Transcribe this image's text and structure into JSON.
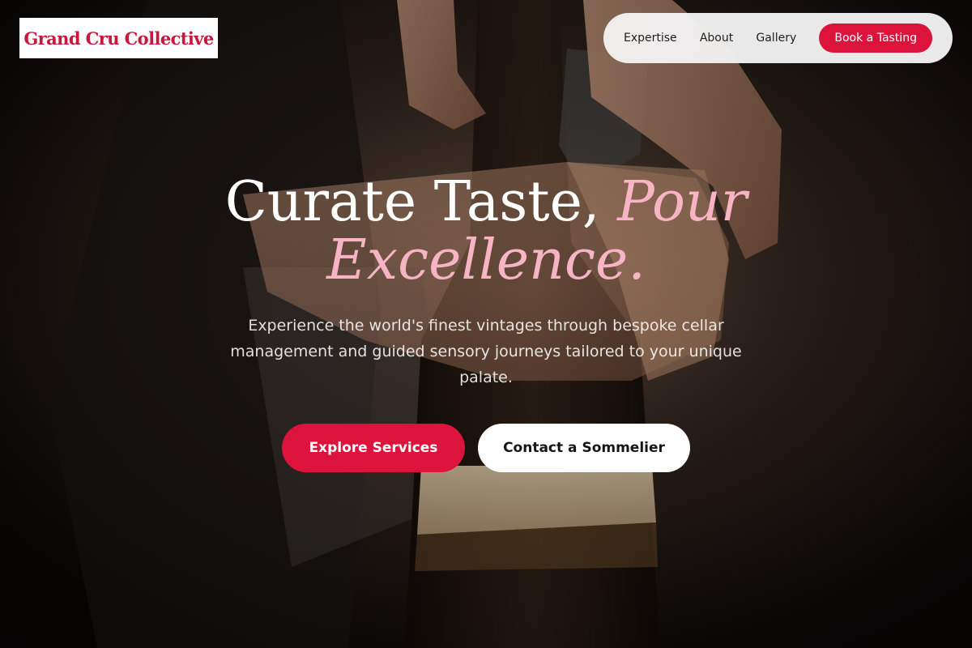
{
  "brand": {
    "logo_text": "Grand Cru Collective"
  },
  "nav": {
    "links": [
      "Expertise",
      "About",
      "Gallery"
    ],
    "cta_label": "Book a Tasting"
  },
  "hero": {
    "headline_part1": "Curate Taste, ",
    "headline_accent": "Pour Excellence.",
    "subtext": "Experience the world's finest vintages through bespoke cellar management and guided sensory journeys tailored to your unique palate.",
    "primary_button": "Explore Services",
    "secondary_button": "Contact a Sommelier"
  },
  "colors": {
    "accent": "#dc143c",
    "headline_accent": "#f7b4c4",
    "logo_text": "#c8173d",
    "nav_background": "#f2f2f2"
  }
}
